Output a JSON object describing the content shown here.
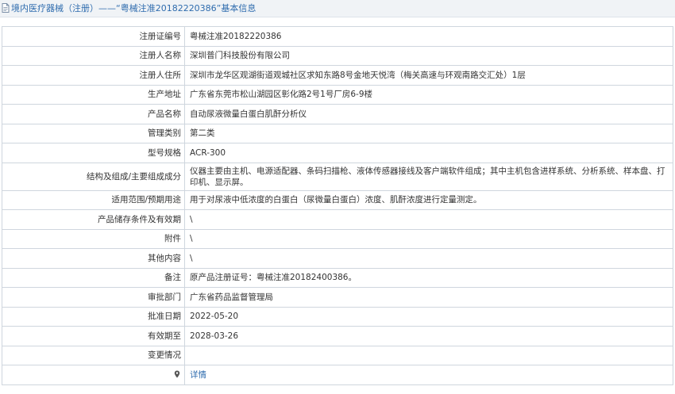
{
  "header": {
    "title": "境内医疗器械（注册）——“粤械注准20182220386”基本信息"
  },
  "rows": [
    {
      "label": "注册证编号",
      "value": "粤械注准20182220386"
    },
    {
      "label": "注册人名称",
      "value": "深圳普门科技股份有限公司"
    },
    {
      "label": "注册人住所",
      "value": "深圳市龙华区观湖街道观城社区求知东路8号金地天悦湾（梅关高速与环观南路交汇处）1层"
    },
    {
      "label": "生产地址",
      "value": "广东省东莞市松山湖园区彰化路2号1号厂房6-9楼"
    },
    {
      "label": "产品名称",
      "value": "自动尿液微量白蛋白肌酐分析仪"
    },
    {
      "label": "管理类别",
      "value": "第二类"
    },
    {
      "label": "型号规格",
      "value": "ACR-300"
    },
    {
      "label": "结构及组成/主要组成成分",
      "value": "仪器主要由主机、电源适配器、条码扫描枪、液体传感器接线及客户端软件组成；其中主机包含进样系统、分析系统、样本盘、打印机、显示屏。"
    },
    {
      "label": "适用范围/预期用途",
      "value": "用于对尿液中低浓度的白蛋白（尿微量白蛋白）浓度、肌酐浓度进行定量测定。"
    },
    {
      "label": "产品储存条件及有效期",
      "value": "\\"
    },
    {
      "label": "附件",
      "value": "\\"
    },
    {
      "label": "其他内容",
      "value": "\\"
    },
    {
      "label": "备注",
      "value": "原产品注册证号：粤械注准20182400386。"
    },
    {
      "label": "审批部门",
      "value": "广东省药品监督管理局"
    },
    {
      "label": "批准日期",
      "value": "2022-05-20"
    },
    {
      "label": "有效期至",
      "value": "2028-03-26"
    },
    {
      "label": "变更情况",
      "value": ""
    }
  ],
  "footer_row": {
    "icon": "map-pin-icon",
    "link_label": "详情"
  },
  "colors": {
    "accent": "#2f6cae",
    "border": "#cfd6de",
    "header_bg": "#f0f3f6"
  }
}
